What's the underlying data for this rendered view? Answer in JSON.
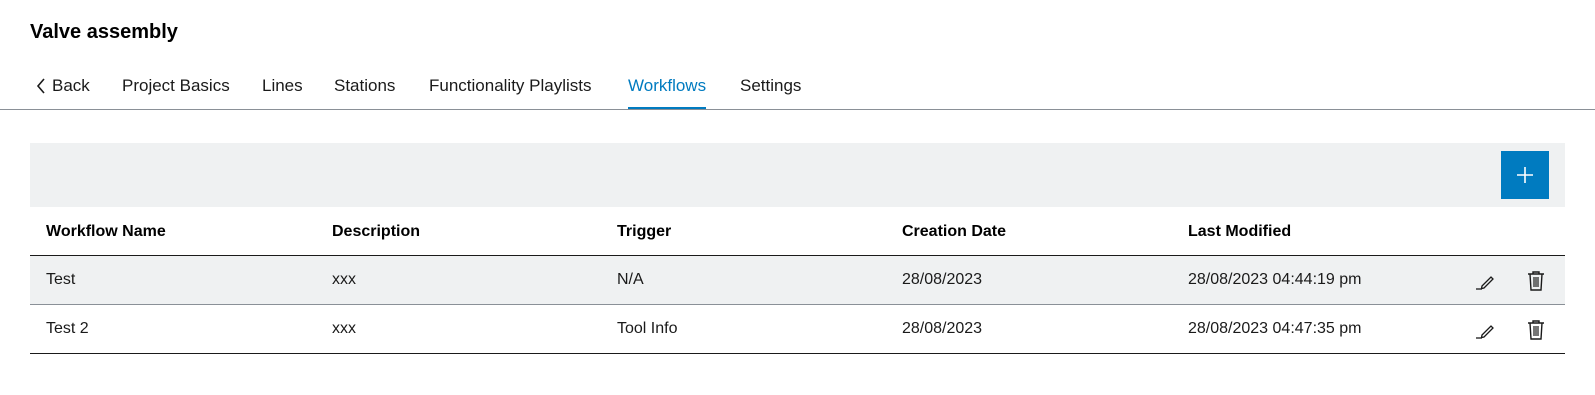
{
  "page": {
    "title": "Valve assembly"
  },
  "nav": {
    "back_label": "Back",
    "tabs": [
      {
        "label": "Project Basics"
      },
      {
        "label": "Lines"
      },
      {
        "label": "Stations"
      },
      {
        "label": "Functionality Playlists"
      },
      {
        "label": "Workflows",
        "active": true
      },
      {
        "label": "Settings"
      }
    ]
  },
  "toolbar": {
    "add_icon": "plus-icon"
  },
  "table": {
    "columns": [
      "Workflow Name",
      "Description",
      "Trigger",
      "Creation Date",
      "Last Modified"
    ],
    "rows": [
      {
        "name": "Test",
        "description": "xxx",
        "trigger": "N/A",
        "created": "28/08/2023",
        "modified": "28/08/2023 04:44:19 pm"
      },
      {
        "name": "Test 2",
        "description": "xxx",
        "trigger": "Tool Info",
        "created": "28/08/2023",
        "modified": "28/08/2023 04:47:35 pm"
      }
    ],
    "row_actions": [
      "edit-icon",
      "trash-icon"
    ]
  },
  "colors": {
    "accent": "#007bc0",
    "toolbar_bg": "#eff1f2",
    "text": "#1a1a1a"
  }
}
